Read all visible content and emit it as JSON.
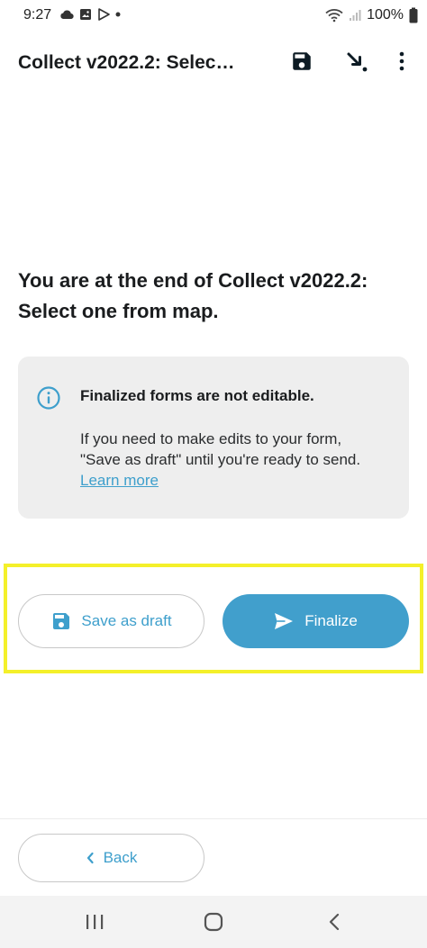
{
  "status_bar": {
    "time": "9:27",
    "battery": "100%",
    "left_icons": [
      "cloud-icon",
      "image-icon",
      "play-store-icon",
      "dot-icon"
    ],
    "right_icons": [
      "wifi-icon",
      "signal-icon",
      "battery-icon"
    ]
  },
  "toolbar": {
    "title": "Collect v2022.2: Selec…",
    "actions": [
      "save-icon",
      "jump-to-icon",
      "more-vert-icon"
    ]
  },
  "main": {
    "end_title": "You are at the end of Collect v2022.2: Select one from map."
  },
  "info_card": {
    "icon": "info-icon",
    "heading": "Finalized forms are not editable.",
    "body": "If you need to make edits to your form, \"Save as draft\" until you're ready to send.",
    "link": "Learn more"
  },
  "actions": {
    "save_draft_label": "Save as draft",
    "finalize_label": "Finalize"
  },
  "footer": {
    "back_label": "Back"
  },
  "colors": {
    "accent": "#419fcc",
    "link": "#3e9fcc",
    "card_bg": "#eeeeee",
    "highlight": "#f4f02a",
    "title": "#1a1c1e"
  }
}
